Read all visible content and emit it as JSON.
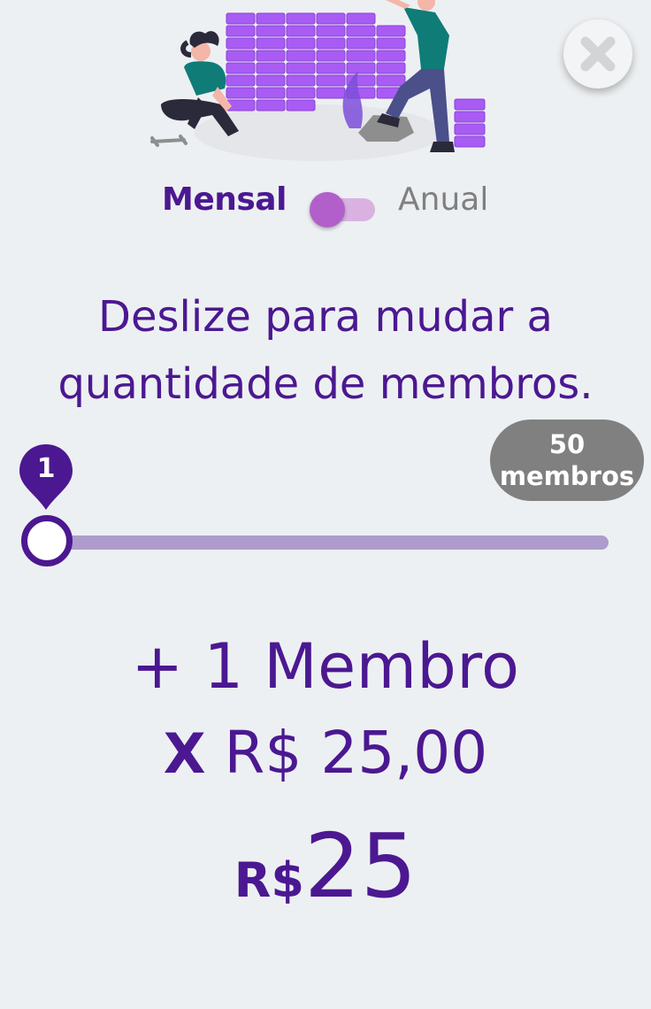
{
  "billing": {
    "monthly_label": "Mensal",
    "yearly_label": "Anual",
    "selected": "monthly"
  },
  "instruction": {
    "line1": "Deslize para mudar a",
    "line2": "quantidade de membros."
  },
  "slider": {
    "value": "1",
    "min": 1,
    "max_value": "50",
    "max_unit": "membros"
  },
  "summary": {
    "plus": "+",
    "count": "1",
    "member_word": "Membro",
    "multiplier": "X",
    "unit_price": "R$ 25,00"
  },
  "total": {
    "currency": "R$",
    "amount": "25"
  },
  "icons": {
    "close": "close-icon",
    "hero": "illustration-building-wall"
  },
  "colors": {
    "primary": "#4b1891",
    "toggle_knob": "#b25fcb",
    "toggle_track": "#dab2e2",
    "slider_track": "#ad9ccd",
    "bubble": "#808080",
    "background": "#edf0f2",
    "bricks": "#a85cf3"
  }
}
